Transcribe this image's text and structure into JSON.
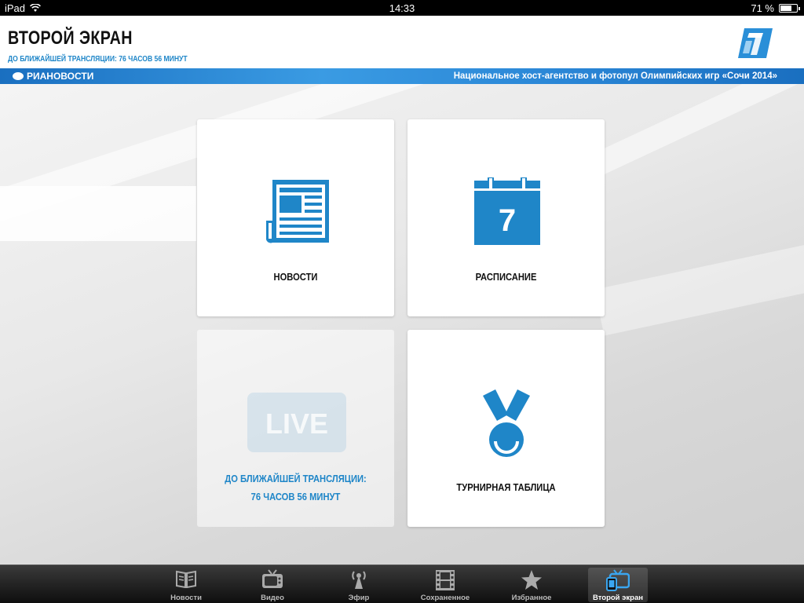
{
  "status_bar": {
    "device": "iPad",
    "time": "14:33",
    "battery": "71 %",
    "battery_level": 0.71
  },
  "header": {
    "title": "ВТОРОЙ ЭКРАН",
    "subtitle": "ДО БЛИЖАЙШЕЙ ТРАНСЛЯЦИИ: 76 ЧАСОВ 56 МИНУТ",
    "logo_icon": "channel-one-logo-icon"
  },
  "banner": {
    "brand": "РИАНОВОСТИ",
    "text": "Национальное хост-агентство и фотопул Олимпийских игр «Сочи 2014»"
  },
  "tiles": {
    "news": {
      "label": "НОВОСТИ",
      "icon": "newspaper-icon"
    },
    "schedule": {
      "label": "РАСПИСАНИЕ",
      "icon": "calendar-icon",
      "day": "7"
    },
    "live": {
      "badge": "LIVE",
      "line1": "ДО БЛИЖАЙШЕЙ ТРАНСЛЯЦИИ:",
      "line2": "76 ЧАСОВ 56 МИНУТ",
      "icon": "live-icon"
    },
    "standings": {
      "label": "ТУРНИРНАЯ ТАБЛИЦА",
      "icon": "medal-icon"
    }
  },
  "tabbar": {
    "items": [
      {
        "label": "Новости",
        "icon": "book-icon"
      },
      {
        "label": "Видео",
        "icon": "tv-icon"
      },
      {
        "label": "Эфир",
        "icon": "antenna-icon"
      },
      {
        "label": "Сохраненное",
        "icon": "film-icon"
      },
      {
        "label": "Избранное",
        "icon": "star-icon"
      },
      {
        "label": "Второй экран",
        "icon": "second-screen-icon"
      }
    ],
    "active_index": 5
  },
  "colors": {
    "accent": "#1f86c8",
    "banner": "#2a86d6"
  }
}
